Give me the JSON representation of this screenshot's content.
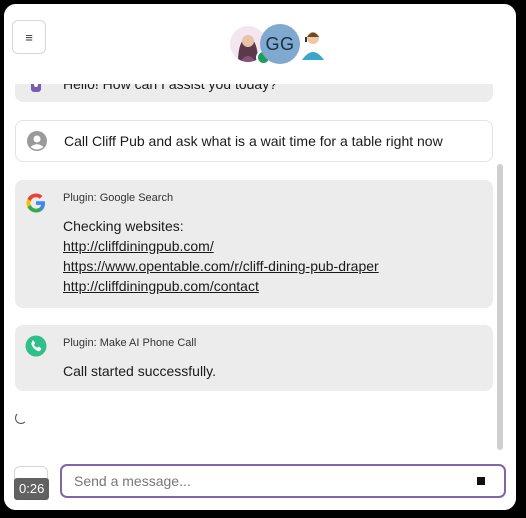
{
  "header": {
    "menu_icon": "hamburger-icon",
    "avatars": {
      "initials": "GG",
      "status_color": "#1f9d5a"
    }
  },
  "messages": {
    "assistant_greeting": "Hello! How can I assist you today?",
    "user_message": "Call Cliff Pub and ask what is a wait time for a table right now",
    "plugin_search": {
      "icon": "google-icon",
      "name": "Plugin: Google Search",
      "body_intro": "Checking websites:",
      "links": [
        "http://cliffdiningpub.com/",
        "https://www.opentable.com/r/cliff-dining-pub-draper",
        "http://cliffdiningpub.com/contact"
      ]
    },
    "plugin_call": {
      "icon": "phone-icon",
      "name": "Plugin: Make AI Phone Call",
      "body": "Call started successfully."
    }
  },
  "composer": {
    "placeholder": "Send a message...",
    "stop_icon": "stop-icon"
  },
  "video": {
    "timestamp": "0:26"
  },
  "colors": {
    "bubble_bg": "#ececec",
    "input_border": "#7e66a8",
    "phone_green": "#2fbf8a"
  }
}
